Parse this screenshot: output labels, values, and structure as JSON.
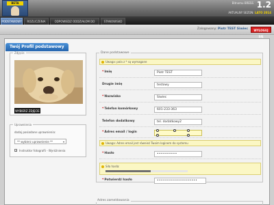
{
  "header": {
    "logo_badge": "BETA",
    "brand": "Bitnomu BRESS",
    "version": "1.2",
    "session_label": "AKTUALNY SEZON:",
    "session_value": "LATO 2014"
  },
  "nav": {
    "tabs": [
      {
        "label": "PODSTAWOWY",
        "active": true
      },
      {
        "label": "ROZLICZENIA",
        "active": false
      },
      {
        "label": "ODPOWIEDZ ODDZIAŁOM DO ZAPISÓW",
        "active": false
      },
      {
        "label": "STANOWISKO",
        "active": false
      }
    ]
  },
  "subbar": {
    "logged_label": "Zalogowany:",
    "logged_user": "Piotr TEST Siwiec",
    "logout_label": "WYLOGUJ SIĘ"
  },
  "page": {
    "title": "Twój Profil podstawowy"
  },
  "photo_box": {
    "legend": "Zdjęcie",
    "change_button": "WYBIERZ ZDJĘCIE"
  },
  "permissions": {
    "legend": "Uprawnienia",
    "add_label": "dodaj posiadane uprawnienia:",
    "select_value": "** wybierz uprawnienie **",
    "checkbox_label": "Instruktor fotografii - Wyróżnienia",
    "checkbox_checked": true
  },
  "form": {
    "legend": "Dane podstawowe",
    "required_note": "Uwaga: pola z * są wymagane",
    "fields": [
      {
        "label": "Imię",
        "required": true,
        "value": "Piotr TEST",
        "highlight": false
      },
      {
        "label": "Drugie imię",
        "required": false,
        "value": "testowy",
        "highlight": false
      },
      {
        "label": "Nazwisko",
        "required": true,
        "value": "Siwiec",
        "highlight": false
      },
      {
        "label": "Telefon komórkowy",
        "required": true,
        "value": "601-233-363",
        "highlight": false
      },
      {
        "label": "Telefon dodatkowy",
        "required": false,
        "value": "tel. dodatkowy2",
        "highlight": false
      },
      {
        "label": "Adres email / login",
        "required": true,
        "value": "",
        "highlight": true
      }
    ],
    "email_note": "Uwaga: Adres email jest również Twoim loginem do systemu",
    "password": {
      "label": "Hasło",
      "required": true,
      "value": "••••••••••"
    },
    "strength": {
      "label": "Siła hasła:",
      "level": 0.55
    },
    "confirm": {
      "label": "Potwierdź hasło",
      "required": true,
      "value": "••••••••••••••••••••"
    }
  },
  "address": {
    "legend": "Adres zameldowania"
  }
}
